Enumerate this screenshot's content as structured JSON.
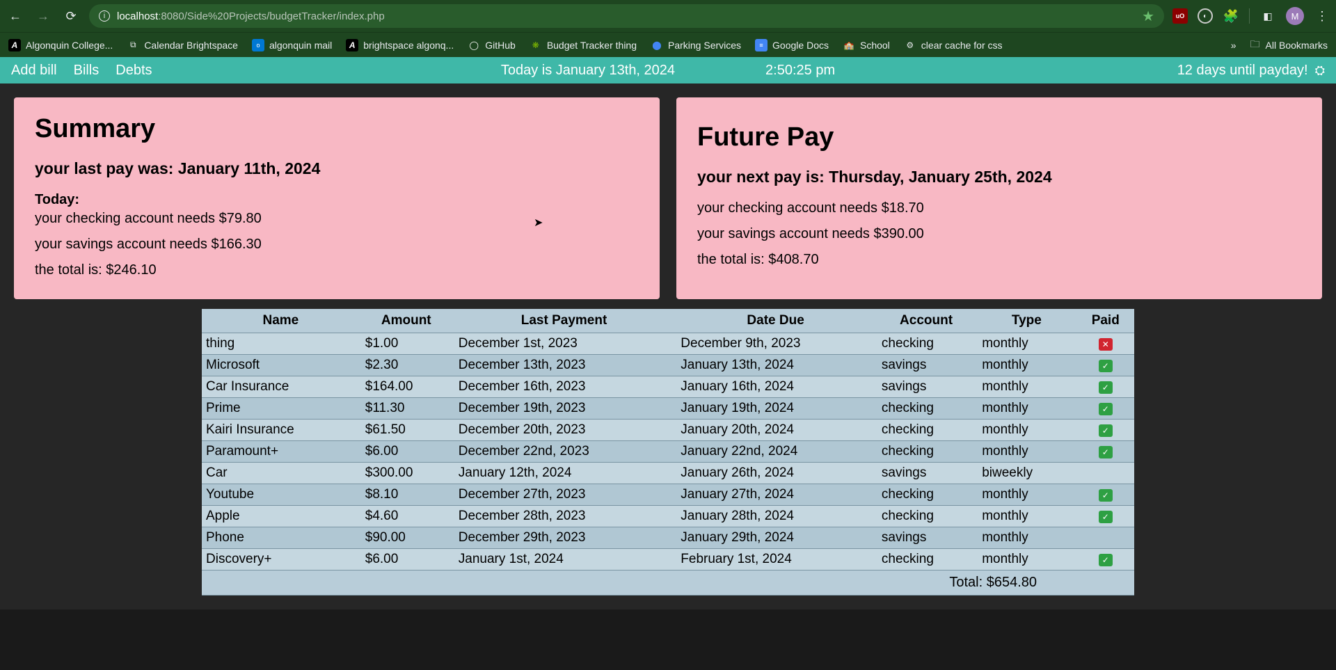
{
  "browser": {
    "url_host": "localhost",
    "url_port": ":8080",
    "url_path": "/Side%20Projects/budgetTracker/index.php",
    "profile_letter": "M",
    "ublock_label": "uO"
  },
  "bookmarks": {
    "items": [
      {
        "label": "Algonquin College...",
        "icon": "A"
      },
      {
        "label": "Calendar Brightspace",
        "icon": "cal"
      },
      {
        "label": "algonquin mail",
        "icon": "mail"
      },
      {
        "label": "brightspace algonq...",
        "icon": "A"
      },
      {
        "label": "GitHub",
        "icon": "gh"
      },
      {
        "label": "Budget Tracker thing",
        "icon": "bt"
      },
      {
        "label": "Parking Services",
        "icon": "park"
      },
      {
        "label": "Google Docs",
        "icon": "docs"
      },
      {
        "label": "School",
        "icon": "school"
      },
      {
        "label": "clear cache for css",
        "icon": "gear"
      }
    ],
    "all_bookmarks": "All Bookmarks"
  },
  "nav": {
    "links": [
      "Add bill",
      "Bills",
      "Debts"
    ],
    "today_label": "Today is January 13th, 2024",
    "time": "2:50:25 pm",
    "payday_countdown": "12 days until payday!"
  },
  "summary": {
    "title": "Summary",
    "last_pay": "your last pay was: January 11th, 2024",
    "today_label": "Today:",
    "checking": "your checking account needs $79.80",
    "savings": "your savings account needs $166.30",
    "total": "the total is: $246.10"
  },
  "future": {
    "title": "Future Pay",
    "next_pay": "your next pay is: Thursday, January 25th, 2024",
    "checking": "your checking account needs $18.70",
    "savings": "your savings account needs $390.00",
    "total": "the total is: $408.70"
  },
  "table": {
    "headers": [
      "Name",
      "Amount",
      "Last Payment",
      "Date Due",
      "Account",
      "Type",
      "Paid"
    ],
    "rows": [
      {
        "name": "thing",
        "amount": "$1.00",
        "last": "December 1st, 2023",
        "due": "December 9th, 2023",
        "acct": "checking",
        "type": "monthly",
        "paid": false
      },
      {
        "name": "Microsoft",
        "amount": "$2.30",
        "last": "December 13th, 2023",
        "due": "January 13th, 2024",
        "acct": "savings",
        "type": "monthly",
        "paid": true
      },
      {
        "name": "Car Insurance",
        "amount": "$164.00",
        "last": "December 16th, 2023",
        "due": "January 16th, 2024",
        "acct": "savings",
        "type": "monthly",
        "paid": true
      },
      {
        "name": "Prime",
        "amount": "$11.30",
        "last": "December 19th, 2023",
        "due": "January 19th, 2024",
        "acct": "checking",
        "type": "monthly",
        "paid": true
      },
      {
        "name": "Kairi Insurance",
        "amount": "$61.50",
        "last": "December 20th, 2023",
        "due": "January 20th, 2024",
        "acct": "checking",
        "type": "monthly",
        "paid": true
      },
      {
        "name": "Paramount+",
        "amount": "$6.00",
        "last": "December 22nd, 2023",
        "due": "January 22nd, 2024",
        "acct": "checking",
        "type": "monthly",
        "paid": true
      },
      {
        "name": "Car",
        "amount": "$300.00",
        "last": "January 12th, 2024",
        "due": "January 26th, 2024",
        "acct": "savings",
        "type": "biweekly",
        "paid": null
      },
      {
        "name": "Youtube",
        "amount": "$8.10",
        "last": "December 27th, 2023",
        "due": "January 27th, 2024",
        "acct": "checking",
        "type": "monthly",
        "paid": true
      },
      {
        "name": "Apple",
        "amount": "$4.60",
        "last": "December 28th, 2023",
        "due": "January 28th, 2024",
        "acct": "checking",
        "type": "monthly",
        "paid": true
      },
      {
        "name": "Phone",
        "amount": "$90.00",
        "last": "December 29th, 2023",
        "due": "January 29th, 2024",
        "acct": "savings",
        "type": "monthly",
        "paid": null
      },
      {
        "name": "Discovery+",
        "amount": "$6.00",
        "last": "January 1st, 2024",
        "due": "February 1st, 2024",
        "acct": "checking",
        "type": "monthly",
        "paid": true
      }
    ],
    "total_label": "Total: $654.80"
  }
}
